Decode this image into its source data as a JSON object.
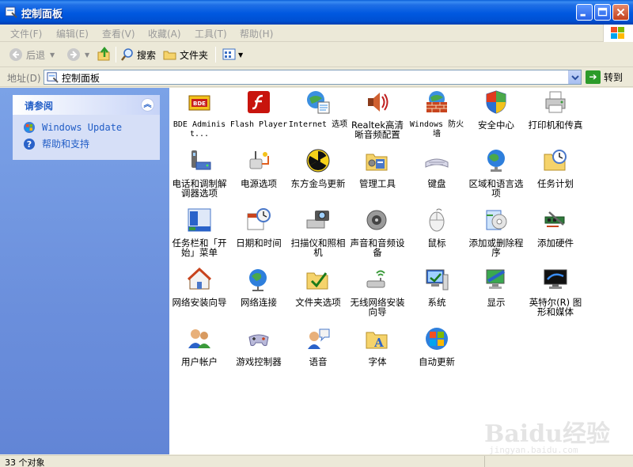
{
  "window": {
    "title": "控制面板",
    "icon": "control-panel-icon"
  },
  "menubar": {
    "items": [
      "文件(F)",
      "编辑(E)",
      "查看(V)",
      "收藏(A)",
      "工具(T)",
      "帮助(H)"
    ]
  },
  "toolbar": {
    "back": "后退",
    "search": "搜索",
    "folders": "文件夹"
  },
  "address": {
    "label": "地址(D)",
    "value": "控制面板",
    "go": "转到"
  },
  "seealso": {
    "title": "请参阅",
    "links": [
      "Windows Update",
      "帮助和支持"
    ]
  },
  "items": [
    {
      "label": "BDE Administ...",
      "icon": "bde-admin-icon"
    },
    {
      "label": "Flash Player",
      "icon": "flash-player-icon"
    },
    {
      "label": "Internet 选项",
      "icon": "internet-options-icon"
    },
    {
      "label": "Realtek高清晰音频配置",
      "icon": "realtek-audio-icon"
    },
    {
      "label": "Windows 防火墙",
      "icon": "firewall-icon"
    },
    {
      "label": "安全中心",
      "icon": "security-center-icon"
    },
    {
      "label": "打印机和传真",
      "icon": "printer-fax-icon"
    },
    {
      "label": "电话和调制解调器选项",
      "icon": "phone-modem-icon"
    },
    {
      "label": "电源选项",
      "icon": "power-options-icon"
    },
    {
      "label": "东方金鸟更新",
      "icon": "radiation-update-icon"
    },
    {
      "label": "管理工具",
      "icon": "admin-tools-icon"
    },
    {
      "label": "键盘",
      "icon": "keyboard-icon"
    },
    {
      "label": "区域和语言选项",
      "icon": "region-language-icon"
    },
    {
      "label": "任务计划",
      "icon": "scheduled-tasks-icon"
    },
    {
      "label": "任务栏和「开始」菜单",
      "icon": "taskbar-start-icon"
    },
    {
      "label": "日期和时间",
      "icon": "date-time-icon"
    },
    {
      "label": "扫描仪和照相机",
      "icon": "scanner-camera-icon"
    },
    {
      "label": "声音和音频设备",
      "icon": "sound-audio-icon"
    },
    {
      "label": "鼠标",
      "icon": "mouse-icon"
    },
    {
      "label": "添加或删除程序",
      "icon": "add-remove-programs-icon"
    },
    {
      "label": "添加硬件",
      "icon": "add-hardware-icon"
    },
    {
      "label": "网络安装向导",
      "icon": "network-setup-icon"
    },
    {
      "label": "网络连接",
      "icon": "network-connections-icon"
    },
    {
      "label": "文件夹选项",
      "icon": "folder-options-icon"
    },
    {
      "label": "无线网络安装向导",
      "icon": "wireless-setup-icon"
    },
    {
      "label": "系统",
      "icon": "system-icon"
    },
    {
      "label": "显示",
      "icon": "display-icon"
    },
    {
      "label": "英特尔(R) 图形和媒体",
      "icon": "intel-graphics-icon"
    },
    {
      "label": "用户帐户",
      "icon": "user-accounts-icon"
    },
    {
      "label": "游戏控制器",
      "icon": "game-controllers-icon"
    },
    {
      "label": "语音",
      "icon": "speech-icon"
    },
    {
      "label": "字体",
      "icon": "fonts-icon"
    },
    {
      "label": "自动更新",
      "icon": "automatic-updates-icon"
    }
  ],
  "status": {
    "text": "33 个对象"
  },
  "watermark": {
    "text": "Baidu经验",
    "sub": "jingyan.baidu.com"
  },
  "colors": {
    "titlebar": "#0058e0",
    "leftpane": "#6b8fdc",
    "link": "#215dc6"
  }
}
